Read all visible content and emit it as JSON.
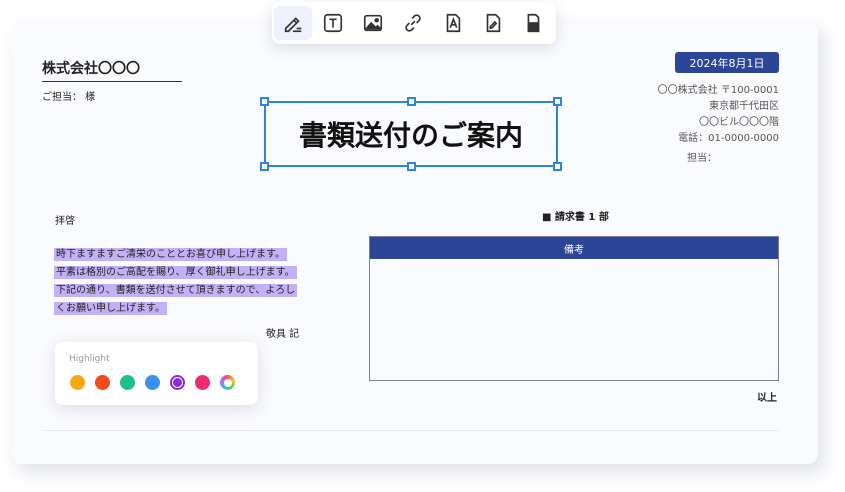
{
  "toolbar": {
    "tools": [
      {
        "name": "pen-edit-icon",
        "active": true
      },
      {
        "name": "text-box-icon"
      },
      {
        "name": "image-icon"
      },
      {
        "name": "link-icon"
      },
      {
        "name": "font-box-icon"
      },
      {
        "name": "edit-page-icon"
      },
      {
        "name": "stamp-icon"
      }
    ]
  },
  "document": {
    "company_name": "株式会社〇〇〇",
    "recipient_contact": "ご担当： 様",
    "date": "2024年8月1日",
    "sender": {
      "company_postal": "〇〇株式会社 〒100-0001",
      "address": "東京都千代田区",
      "building": "〇〇ビル〇〇〇階",
      "phone": "電話：01-0000-0000",
      "contact": "担当："
    },
    "title": "書類送付のご案内",
    "greeting": "拝啓",
    "body_lines": [
      "時下ますますご清栄のこととお喜び申し上げます。",
      "平素は格別のご高配を賜り、厚く御礼申し上げます。",
      "下記の通り、書類を送付させて頂きますので、よろし",
      "くお願い申し上げます。"
    ],
    "closing": "敬具 記",
    "enclosure": "■ 請求書 1 部",
    "table_header": "備考",
    "end_mark": "以上"
  },
  "highlight_palette": {
    "label": "Highlight",
    "colors": [
      "#f5a80f",
      "#f04a1e",
      "#1dbf8a",
      "#3b8ff0",
      "#8a2be2",
      "#ef2b72",
      "rainbow"
    ],
    "selected_index": 4
  },
  "colors": {
    "accent_blue": "#2c4596",
    "selection_blue": "#2b86e0",
    "highlight_purple": "#c4b0f7"
  }
}
